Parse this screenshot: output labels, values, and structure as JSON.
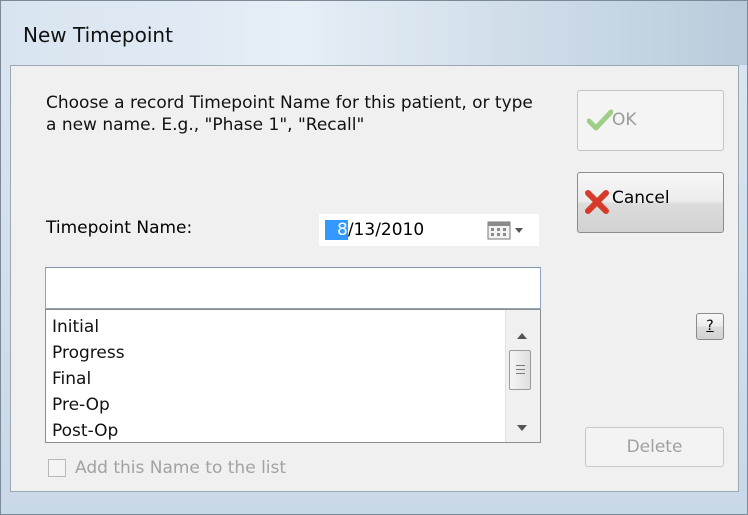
{
  "window": {
    "title": "New Timepoint"
  },
  "prompt": "Choose a record Timepoint Name for this patient, or type a new name.  E.g., \"Phase 1\", \"Recall\"",
  "buttons": {
    "ok_label": "OK",
    "cancel_label": "Cancel",
    "help_label": "?",
    "delete_label": "Delete"
  },
  "timepoint": {
    "label": "Timepoint Name:",
    "date_selected_part": "8",
    "date_rest": "/13/2010",
    "name_value": ""
  },
  "list": {
    "items": [
      "Initial",
      "Progress",
      "Final",
      "Pre-Op",
      "Post-Op"
    ]
  },
  "checkbox": {
    "label": "Add this Name to the list",
    "checked": false
  },
  "colors": {
    "ok_check": "#6dbd45",
    "cancel_x": "#d83a2a",
    "selection": "#3399ff"
  },
  "icons": {
    "ok": "checkmark-icon",
    "cancel": "red-x-icon",
    "calendar": "calendar-icon"
  }
}
